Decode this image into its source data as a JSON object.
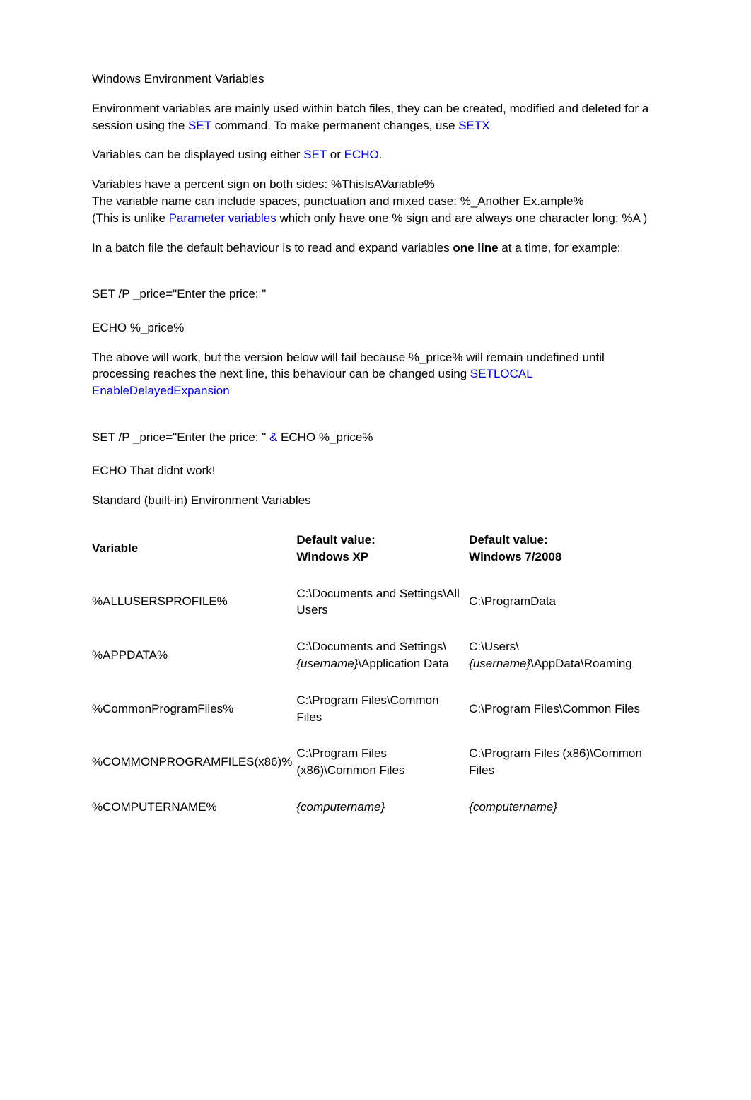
{
  "title": "Windows Environment Variables",
  "p1_a": "Environment variables are mainly used within batch files, they can be created, modified and deleted for a session using the ",
  "p1_link1": "SET",
  "p1_b": " command. To make permanent changes, use ",
  "p1_link2": "SETX",
  "p2_a": "Variables can be displayed using either ",
  "p2_link1": "SET",
  "p2_b": " or ",
  "p2_link2": "ECHO",
  "p2_c": ".",
  "p3_a": "Variables have a percent sign on both sides: %ThisIsAVariable%",
  "p3_b": "The variable name can include spaces, punctuation and mixed case: %_Another Ex.ample%",
  "p3_c": "(This is unlike ",
  "p3_link1": "Parameter variables",
  "p3_d": " which only have one % sign and are always one character long: %A )",
  "p4_a": "In a batch file the default behaviour is to read and expand variables ",
  "p4_bold": "one line",
  "p4_b": " at a time, for example:",
  "code1_a": "SET /P _price=\"Enter the price: \"",
  "code1_b": "ECHO %_price%",
  "p5_a": "The above will work, but the version below will fail because %_price% will remain undefined until processing reaches the next line, this behaviour can be changed using ",
  "p5_link1": "SETLOCAL EnableDelayedExpansion",
  "code2_a": "SET /P _price=\"Enter the price: \" ",
  "code2_amp": "&",
  "code2_b": " ECHO %_price%",
  "code2_c": "ECHO That didnt work!",
  "h2": "Standard (built-in) Environment Variables",
  "th1": "Variable",
  "th2a": "Default value:",
  "th2b": "Windows XP",
  "th3a": "Default value:",
  "th3b": "Windows 7/2008",
  "r1_var": "%ALLUSERSPROFILE%",
  "r1_xp": "C:\\Documents and Settings\\All Users",
  "r1_7": "C:\\ProgramData",
  "r2_var": "%APPDATA%",
  "r2_xp_a": "C:\\Documents and Settings\\",
  "r2_xp_ital": "{username}",
  "r2_xp_b": "\\Application Data",
  "r2_7_a": "C:\\Users\\",
  "r2_7_ital": "{username}",
  "r2_7_b": "\\AppData\\Roaming",
  "r3_var": "%CommonProgramFiles%",
  "r3_xp": "C:\\Program Files\\Common Files",
  "r3_7": "C:\\Program Files\\Common Files",
  "r4_var": "%COMMONPROGRAMFILES(x86)%",
  "r4_xp": "C:\\Program Files (x86)\\Common Files",
  "r4_7": "C:\\Program Files (x86)\\Common Files",
  "r5_var": "%COMPUTERNAME%",
  "r5_xp": "{computername}",
  "r5_7": "{computername}"
}
